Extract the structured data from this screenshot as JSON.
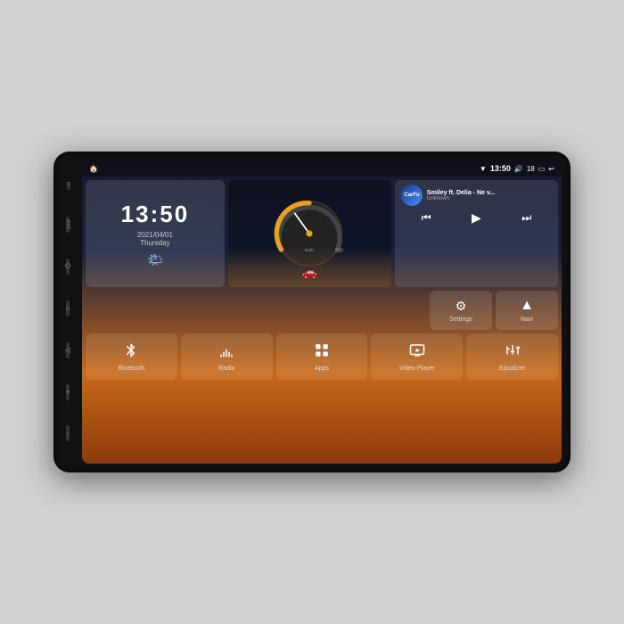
{
  "device": {
    "side_labels": [
      "MIC",
      "RST"
    ]
  },
  "status_bar": {
    "left_icons": [
      "home",
      "wifi"
    ],
    "time": "13:50",
    "right_icons": [
      "volume",
      "18",
      "screen",
      "back"
    ]
  },
  "clock_widget": {
    "time": "13:50",
    "date": "2021/04/01",
    "day": "Thursday",
    "weather_icon": "🌤"
  },
  "music_widget": {
    "logo_text": "CarFu",
    "title": "Smiley ft. Delia - Ne v...",
    "artist": "Unknown",
    "controls": {
      "prev": "⏮",
      "play": "▶",
      "next": "⏭"
    }
  },
  "nav_buttons": [
    {
      "id": "settings",
      "icon": "⚙",
      "label": "Settings"
    },
    {
      "id": "navi",
      "icon": "▲",
      "label": "Navi"
    }
  ],
  "app_buttons": [
    {
      "id": "bluetooth",
      "label": "Bluetooth"
    },
    {
      "id": "radio",
      "label": "Radio"
    },
    {
      "id": "apps",
      "label": "Apps"
    },
    {
      "id": "video-player",
      "label": "Video Player"
    },
    {
      "id": "equalizer",
      "label": "Equalizer"
    }
  ],
  "speedometer": {
    "unit": "km/h"
  }
}
